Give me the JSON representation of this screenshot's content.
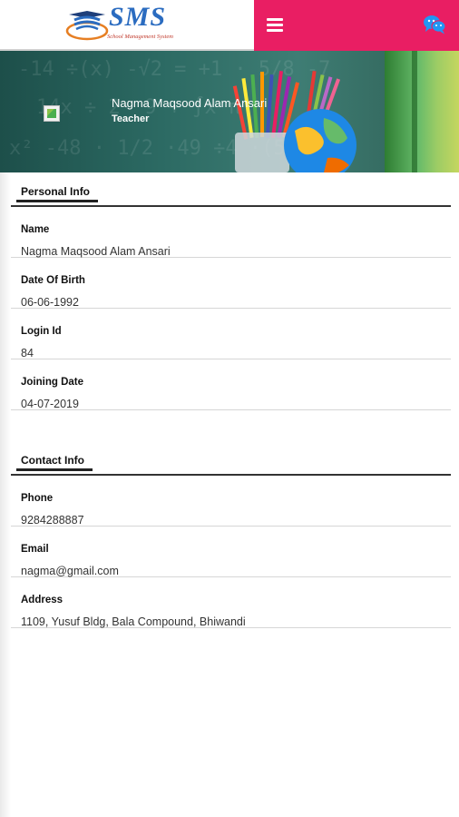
{
  "header": {
    "logo_text": "SMS",
    "logo_tagline": "School Management System"
  },
  "profile": {
    "name": "Nagma Maqsood Alam Ansari",
    "role": "Teacher"
  },
  "personal_info": {
    "title": "Personal Info",
    "fields": [
      {
        "label": "Name",
        "value": "Nagma Maqsood Alam Ansari"
      },
      {
        "label": "Date Of Birth",
        "value": "06-06-1992"
      },
      {
        "label": "Login Id",
        "value": "84"
      },
      {
        "label": "Joining Date",
        "value": "04-07-2019"
      }
    ]
  },
  "contact_info": {
    "title": "Contact Info",
    "fields": [
      {
        "label": "Phone",
        "value": "9284288887"
      },
      {
        "label": "Email",
        "value": "nagma@gmail.com"
      },
      {
        "label": "Address",
        "value": "1109, Yusuf Bldg, Bala Compound, Bhiwandi"
      }
    ]
  },
  "colors": {
    "accent": "#e91e63",
    "chat_icon": "#2196f3",
    "banner": "#2c6a63"
  },
  "icons": {
    "menu": "hamburger-menu-icon",
    "chat": "chat-bubbles-icon"
  }
}
